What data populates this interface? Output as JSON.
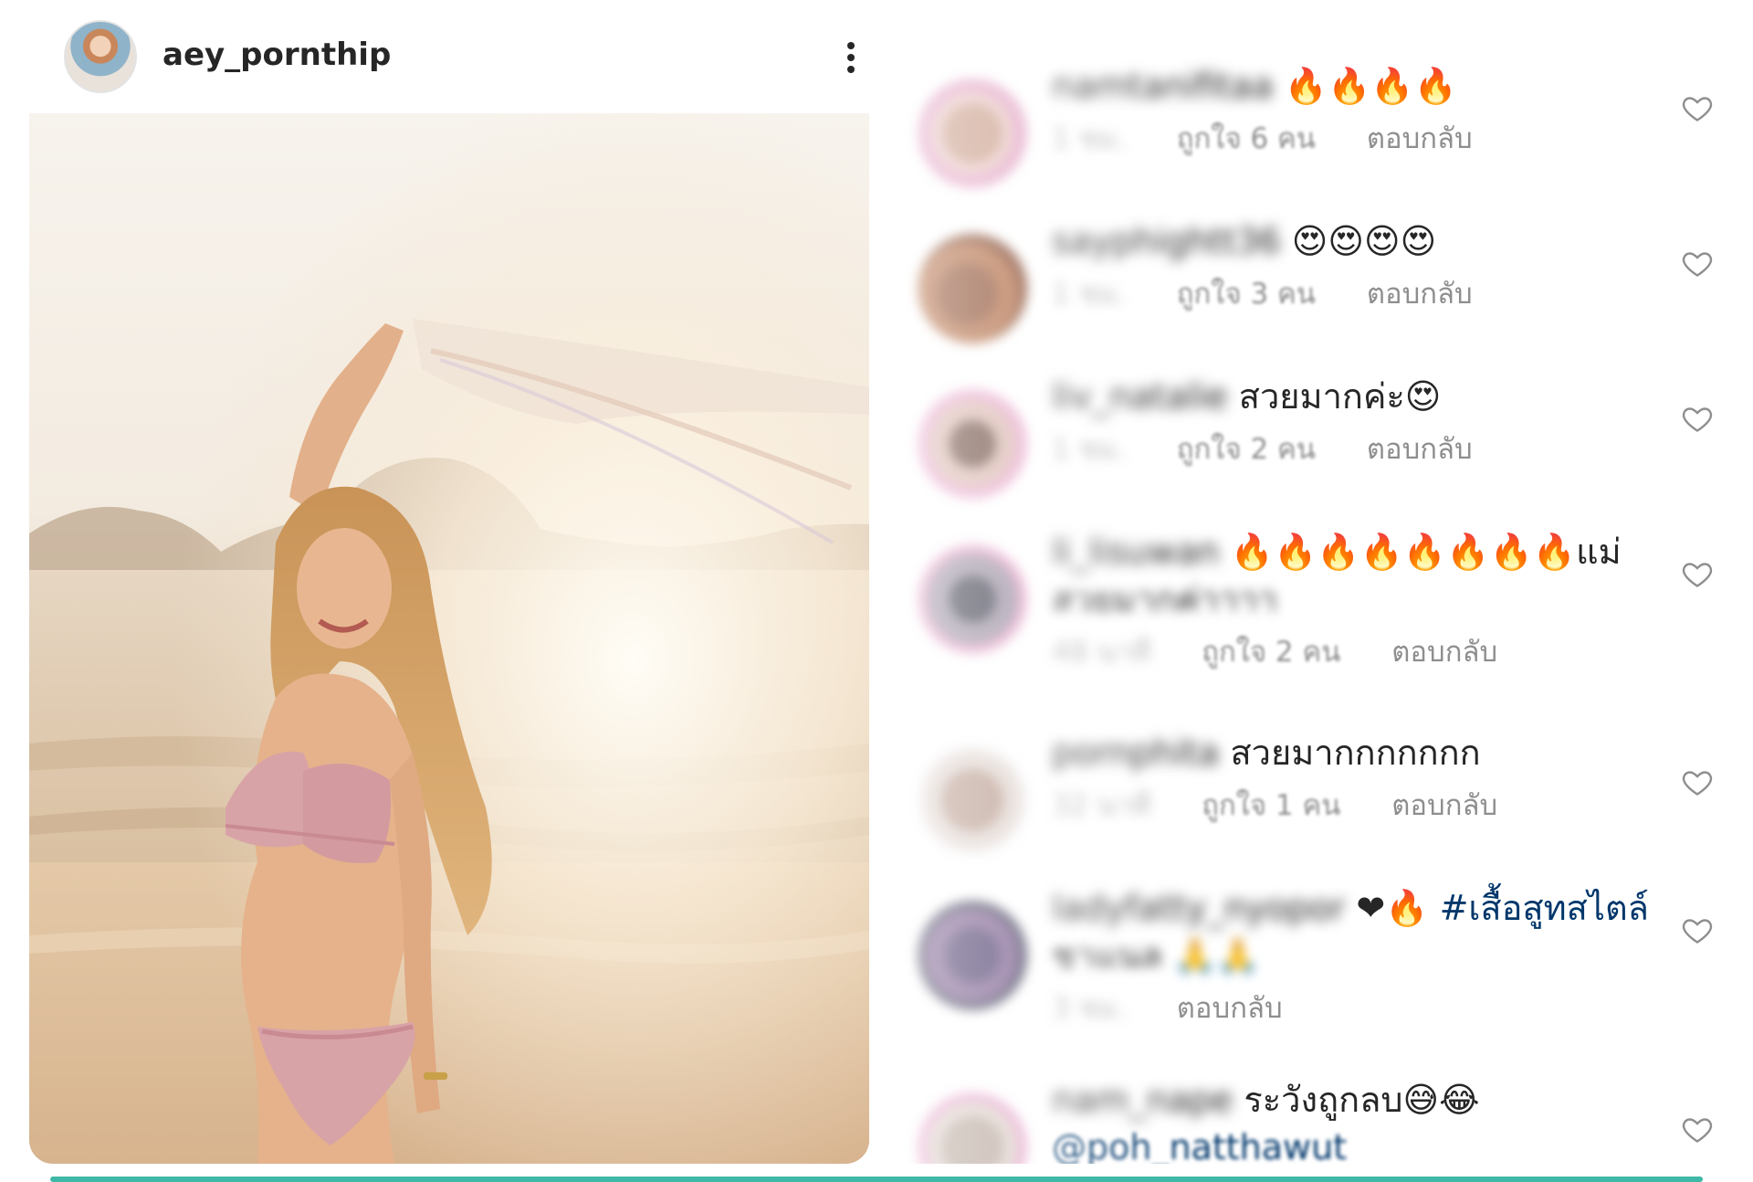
{
  "post": {
    "username": "aey_pornthip",
    "avatar_icon": "profile-avatar",
    "more_icon": "more-vertical-icon",
    "image_alt": "woman in bikini on beach at sunset"
  },
  "comments": [
    {
      "user": "namtanifitaa",
      "text": "🔥🔥🔥🔥",
      "time": "1 ชม.",
      "likes": "ถูกใจ 6 คน",
      "reply": "ตอบกลับ"
    },
    {
      "user": "sayphightt36",
      "text": "😍😍😍😍",
      "time": "1 ชม.",
      "likes": "ถูกใจ 3 คน",
      "reply": "ตอบกลับ"
    },
    {
      "user": "liv_natalie",
      "text": "สวยมากค่ะ😍",
      "time": "1 ชม.",
      "likes": "ถูกใจ 2 คน",
      "reply": "ตอบกลับ"
    },
    {
      "user": "li_lisuwan",
      "text": "🔥🔥🔥🔥🔥🔥🔥🔥แม่",
      "text2": "สวยมากค่าาาา",
      "time": "48 นาที",
      "likes": "ถูกใจ 2 คน",
      "reply": "ตอบกลับ"
    },
    {
      "user": "pornphita",
      "text": "สวยมากกกกกกก",
      "time": "32 นาที",
      "likes": "ถูกใจ 1 คน",
      "reply": "ตอบกลับ"
    },
    {
      "user": "ladyfatty_nyopor",
      "text": "❤🔥",
      "tag": "#เสื้อสูทสไตล์",
      "text2": "ชาแนล 🙏🙏",
      "time": "3 ชม.",
      "reply": "ตอบกลับ"
    },
    {
      "user": "nam_nape",
      "text": "ระวังถูกลบ😅😂",
      "mention": "@poh_natthawut"
    }
  ],
  "icons": {
    "heart": "heart-outline-icon"
  },
  "colors": {
    "text": "#262626",
    "muted": "#8e8e8e",
    "link": "#00376b",
    "accent_strip": "#3fb8a7"
  }
}
